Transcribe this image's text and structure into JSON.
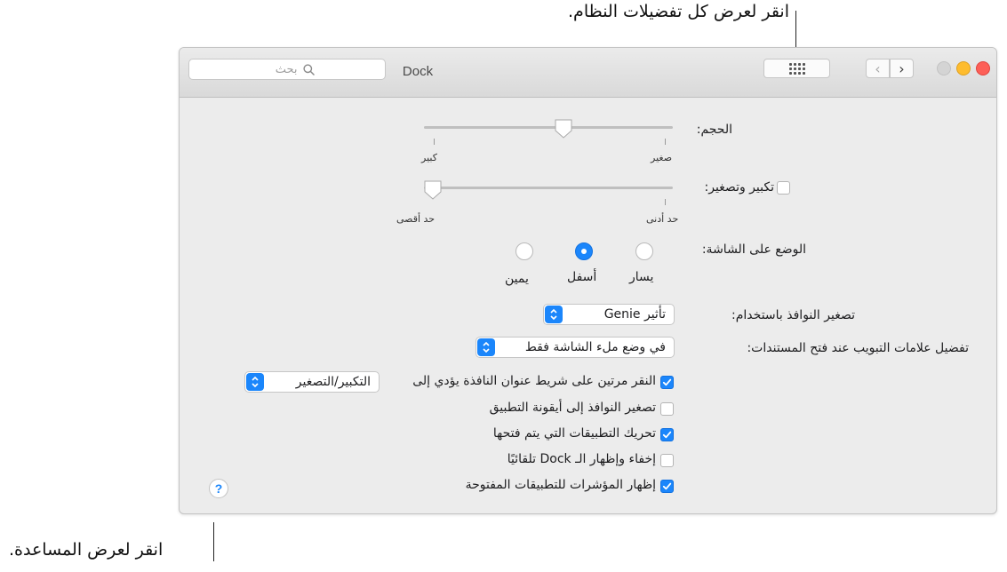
{
  "callouts": {
    "top": "انقر لعرض كل تفضيلات النظام.",
    "bottom": "انقر لعرض المساعدة."
  },
  "window": {
    "title": "Dock",
    "search_placeholder": "بحث",
    "nav_back_glyph": "‹",
    "nav_forward_glyph": "›"
  },
  "size": {
    "label": "الحجم:",
    "min_label": "صغير",
    "max_label": "كبير",
    "value_fraction": 0.55
  },
  "magnification": {
    "label": "تكبير وتصغير:",
    "checked": false,
    "min_label": "حد أدنى",
    "max_label": "حد أقصى",
    "value_fraction": 0.0
  },
  "position": {
    "label": "الوضع على الشاشة:",
    "options": [
      "يسار",
      "أسفل",
      "يمين"
    ],
    "selected": "أسفل"
  },
  "minimize_using": {
    "label": "تصغير النوافذ باستخدام:",
    "value": "تأثير Genie"
  },
  "prefer_tabs": {
    "label": "تفضيل علامات التبويب عند فتح المستندات:",
    "value": "في وضع ملء الشاشة فقط"
  },
  "double_click": {
    "label": "النقر مرتين على شريط عنوان النافذة يؤدي إلى",
    "checked": true,
    "value": "التكبير/التصغير"
  },
  "options": [
    {
      "label": "تصغير النوافذ إلى أيقونة التطبيق",
      "checked": false
    },
    {
      "label": "تحريك التطبيقات التي يتم فتحها",
      "checked": true
    },
    {
      "label": "إخفاء وإظهار الـ Dock تلقائيًا",
      "checked": false
    },
    {
      "label": "إظهار المؤشرات للتطبيقات المفتوحة",
      "checked": true
    }
  ],
  "help": {
    "glyph": "?"
  },
  "colors": {
    "accent": "#1b86fb",
    "close": "#fd5f57",
    "minimize": "#febc2e",
    "zoom_disabled": "#d4d4d4"
  }
}
